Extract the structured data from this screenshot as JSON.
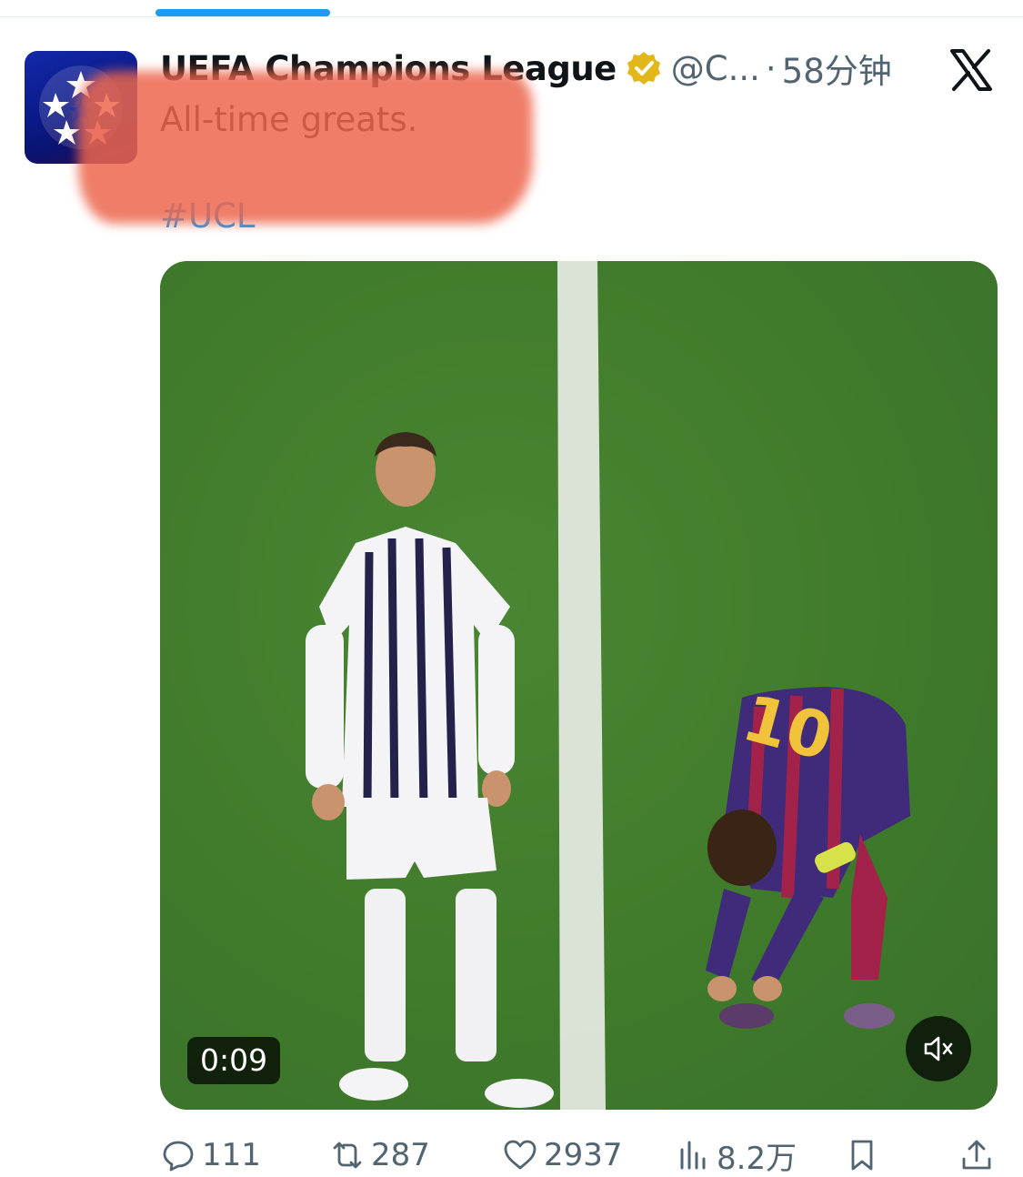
{
  "author": {
    "display_name": "UEFA Champions League",
    "handle": "@C...",
    "separator": "·",
    "time_ago": "58分钟",
    "verified": true,
    "verified_badge_color": "#e2b719"
  },
  "tweet": {
    "text": "All-time greats.",
    "hashtag": "#UCL"
  },
  "media": {
    "type": "video",
    "duration": "0:09",
    "muted": true
  },
  "actions": {
    "replies": "111",
    "retweets": "287",
    "likes": "2937",
    "views": "8.2万"
  },
  "icons": [
    "x-logo-icon",
    "verified-badge-icon",
    "reply-icon",
    "retweet-icon",
    "like-icon",
    "views-icon",
    "bookmark-icon",
    "share-icon",
    "mute-icon"
  ],
  "colors": {
    "accent": "#1d9bf0",
    "text": "#0f1419",
    "secondary": "#536471",
    "redaction": "#ec664e"
  }
}
